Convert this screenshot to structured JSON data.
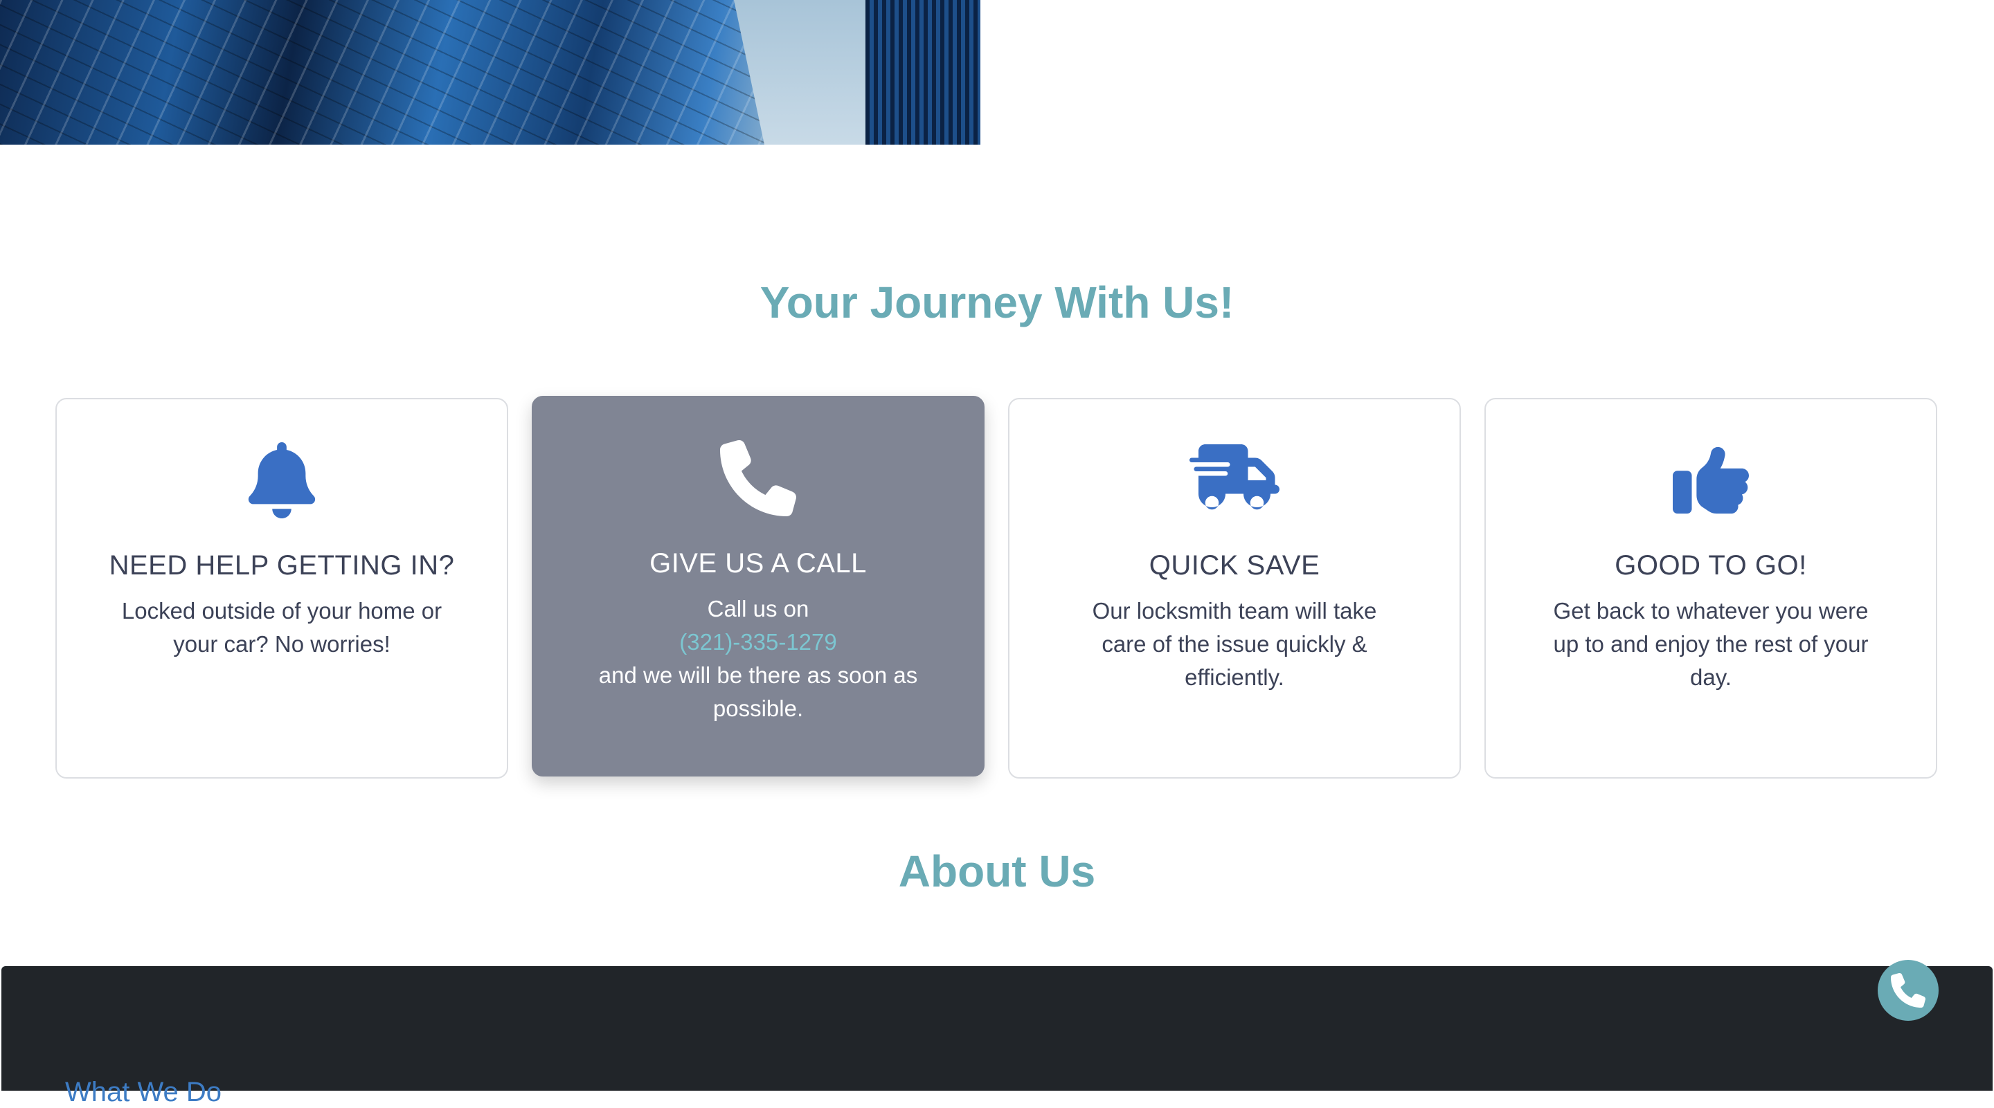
{
  "journey": {
    "title": "Your Journey With Us!",
    "cards": [
      {
        "icon": "bell-icon",
        "title": "NEED HELP GETTING IN?",
        "text": "Locked outside of your home or your car? No worries!"
      },
      {
        "icon": "phone-icon",
        "title": "GIVE US A CALL",
        "text_before": "Call us on",
        "phone": "(321)-335-1279",
        "text_after": "and we will be there as soon as possible."
      },
      {
        "icon": "truck-fast-icon",
        "title": "QUICK SAVE",
        "text": "Our locksmith team will take care of the issue quickly & efficiently."
      },
      {
        "icon": "thumbs-up-icon",
        "title": "GOOD TO GO!",
        "text": "Get back to whatever you were up to and enjoy the rest of your day."
      }
    ]
  },
  "about": {
    "title": "About Us"
  },
  "footer": {
    "heading": "What We Do"
  },
  "colors": {
    "accent": "#6aabb5",
    "icon_blue": "#3a6fc4",
    "active_card": "#808594",
    "footer_bg": "#212529"
  }
}
